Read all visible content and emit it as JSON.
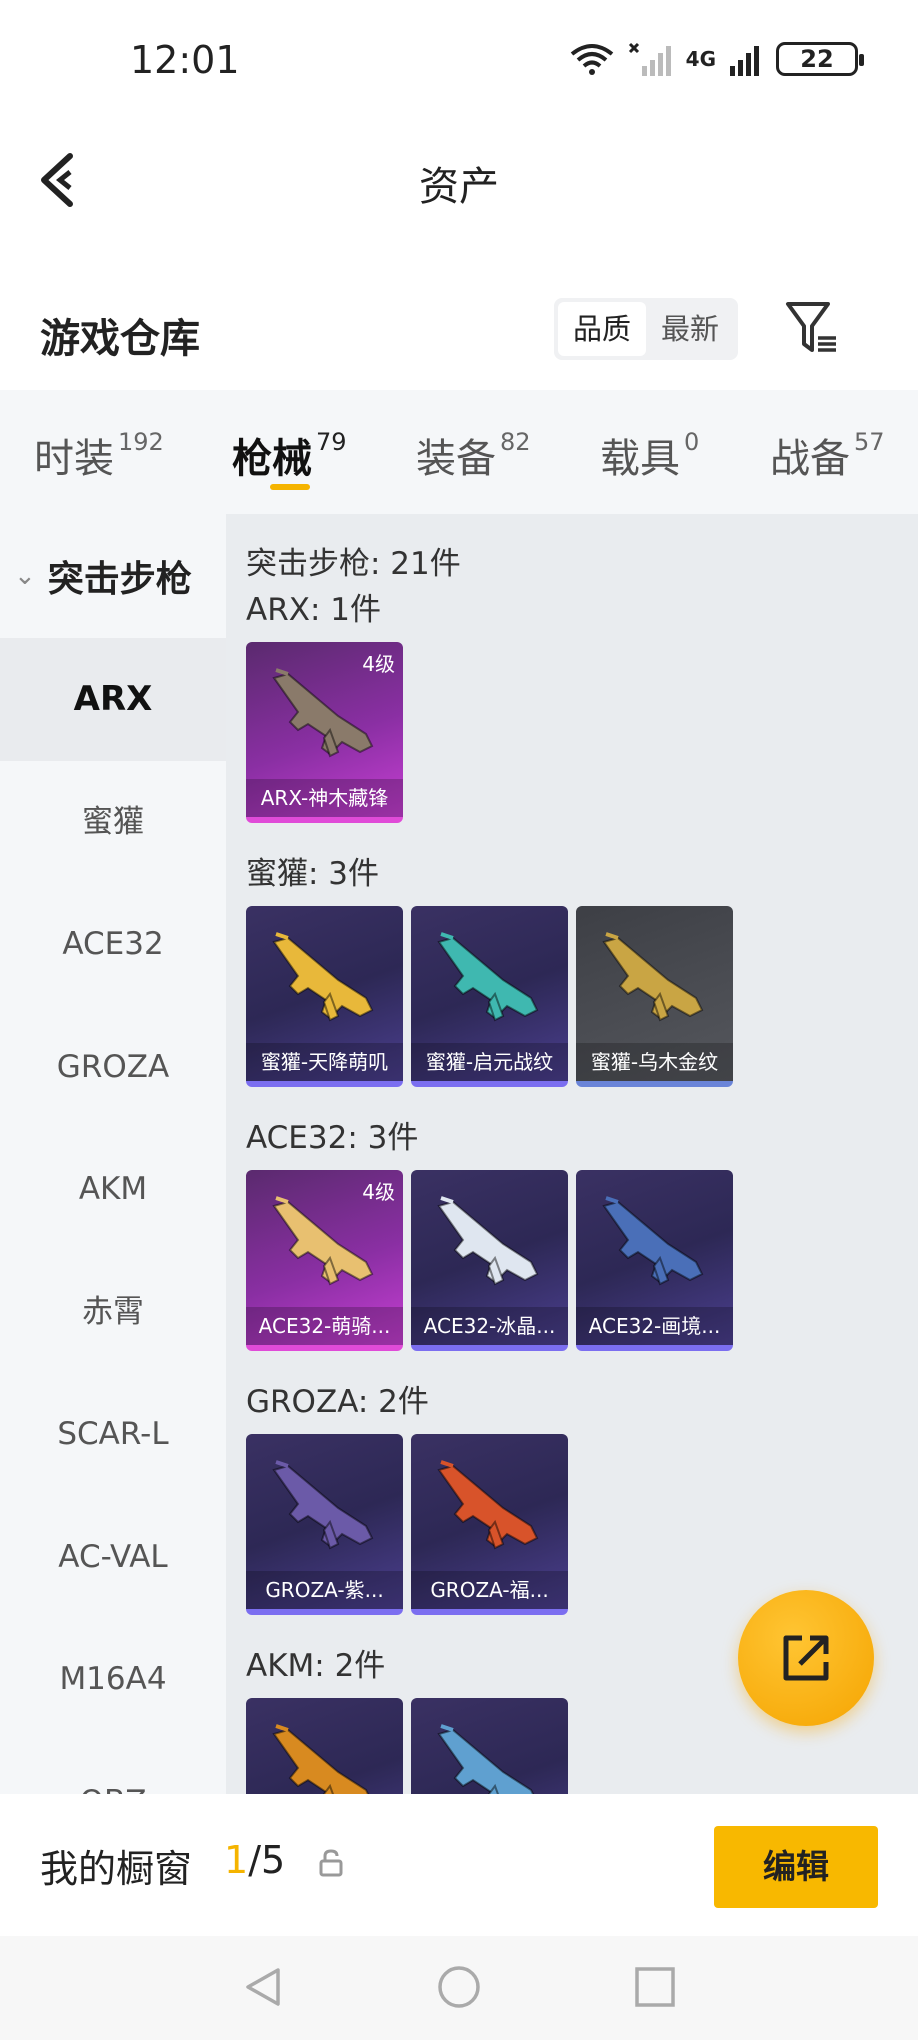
{
  "status_bar": {
    "time": "12:01",
    "network": "4G",
    "battery": "22"
  },
  "header": {
    "title": "资产"
  },
  "warehouse": {
    "title": "游戏仓库",
    "sort_options": [
      {
        "label": "品质",
        "active": true
      },
      {
        "label": "最新",
        "active": false
      }
    ]
  },
  "tabs": [
    {
      "label": "时装",
      "count": "192",
      "active": false
    },
    {
      "label": "枪械",
      "count": "79",
      "active": true
    },
    {
      "label": "装备",
      "count": "82",
      "active": false
    },
    {
      "label": "载具",
      "count": "0",
      "active": false
    },
    {
      "label": "战备",
      "count": "57",
      "active": false
    }
  ],
  "sidebar": {
    "category": "突击步枪",
    "items": [
      "ARX",
      "蜜獾",
      "ACE32",
      "GROZA",
      "AKM",
      "赤霄",
      "SCAR-L",
      "AC-VAL",
      "M16A4",
      "QBZ"
    ],
    "active": "ARX"
  },
  "content": {
    "total": "突击步枪: 21件",
    "groups": [
      {
        "title": "ARX: 1件",
        "items": [
          {
            "name": "ARX-神木藏锋",
            "level": "4级",
            "rarity": "pink"
          }
        ]
      },
      {
        "title": "蜜獾: 3件",
        "items": [
          {
            "name": "蜜獾-天降萌叽",
            "level": "",
            "rarity": "purple"
          },
          {
            "name": "蜜獾-启元战纹",
            "level": "",
            "rarity": "purple"
          },
          {
            "name": "蜜獾-乌木金纹",
            "level": "",
            "rarity": "gray"
          }
        ]
      },
      {
        "title": "ACE32: 3件",
        "items": [
          {
            "name": "ACE32-萌骑...",
            "level": "4级",
            "rarity": "pink"
          },
          {
            "name": "ACE32-冰晶...",
            "level": "",
            "rarity": "purple"
          },
          {
            "name": "ACE32-画境...",
            "level": "",
            "rarity": "purple"
          }
        ]
      },
      {
        "title": "GROZA: 2件",
        "items": [
          {
            "name": "GROZA-紫...",
            "level": "",
            "rarity": "purple"
          },
          {
            "name": "GROZA-福...",
            "level": "",
            "rarity": "purple"
          }
        ]
      },
      {
        "title": "AKM: 2件",
        "items": [
          {
            "name": "",
            "level": "",
            "rarity": "purple"
          },
          {
            "name": "",
            "level": "",
            "rarity": "purple"
          }
        ]
      }
    ]
  },
  "showcase": {
    "label": "我的橱窗",
    "current": "1",
    "total": "/5",
    "edit_label": "编辑"
  },
  "colors": {
    "accent": "#f5b400",
    "rarity_pink": "#e04bd8",
    "rarity_purple": "#7b6ef0",
    "rarity_gray": "#6a84d8"
  }
}
